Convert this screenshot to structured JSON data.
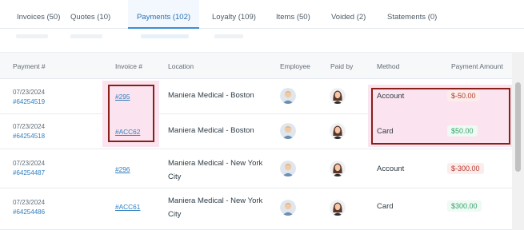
{
  "tabs": [
    {
      "label": "Invoices (50)",
      "active": false
    },
    {
      "label": "Quotes (10)",
      "active": false
    },
    {
      "label": "Payments (102)",
      "active": true
    },
    {
      "label": "Loyalty (109)",
      "active": false
    },
    {
      "label": "Items (50)",
      "active": false
    },
    {
      "label": "Voided (2)",
      "active": false
    },
    {
      "label": "Statements (0)",
      "active": false
    }
  ],
  "table": {
    "columns": [
      "Payment #",
      "Invoice #",
      "Location",
      "Employee",
      "Paid by",
      "Method",
      "Payment Amount"
    ],
    "rows": [
      {
        "date": "07/23/2024",
        "payment_no": "#64254519",
        "invoice": "#295",
        "location": "Maniera Medical - Boston",
        "method": "Account",
        "amount": "$-50.00",
        "amount_status": "negative"
      },
      {
        "date": "07/23/2024",
        "payment_no": "#64254518",
        "invoice": "#ACC62",
        "location": "Maniera Medical - Boston",
        "method": "Card",
        "amount": "$50.00",
        "amount_status": "positive"
      },
      {
        "date": "07/23/2024",
        "payment_no": "#64254487",
        "invoice": "#296",
        "location": "Maniera Medical - New York City",
        "method": "Account",
        "amount": "$-300.00",
        "amount_status": "negative"
      },
      {
        "date": "07/23/2024",
        "payment_no": "#64254486",
        "invoice": "#ACC61",
        "location": "Maniera Medical - New York City",
        "method": "Card",
        "amount": "$300.00",
        "amount_status": "positive"
      }
    ]
  },
  "colors": {
    "accent": "#3a8fd6",
    "link": "#2f7fc1",
    "negative": "#b1392c",
    "positive": "#35a26b",
    "highlight_border": "#8a1f17",
    "highlight_fill": "#fbe3ef"
  },
  "icons": {
    "employee": "employee-avatar-icon",
    "paid_by": "customer-avatar-icon"
  }
}
